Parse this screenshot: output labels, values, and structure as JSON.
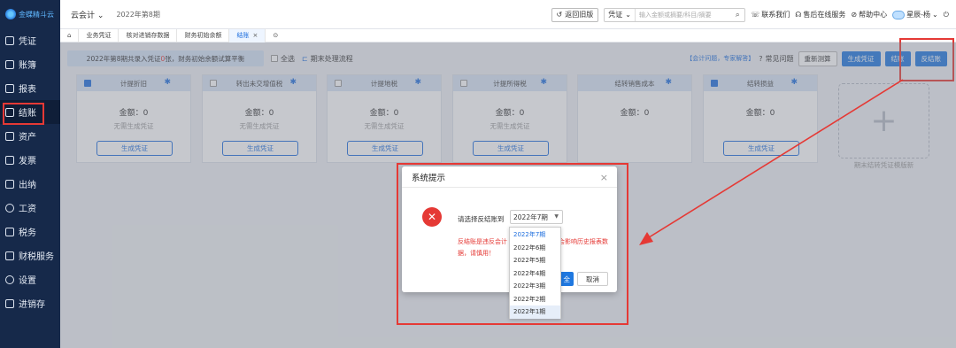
{
  "sidebar": {
    "logo": "金蝶精斗云",
    "items": [
      {
        "label": "凭证"
      },
      {
        "label": "账簿"
      },
      {
        "label": "报表"
      },
      {
        "label": "结账"
      },
      {
        "label": "资产"
      },
      {
        "label": "发票"
      },
      {
        "label": "出纳"
      },
      {
        "label": "工资"
      },
      {
        "label": "税务"
      },
      {
        "label": "财税服务"
      },
      {
        "label": "设置"
      },
      {
        "label": "进销存"
      }
    ]
  },
  "header": {
    "app": "云会计",
    "period": "2022年第8期",
    "return_old": "返回旧版",
    "search_select": "凭证",
    "search_placeholder": "输入金额或摘要/科目/摘要",
    "contact": "联系我们",
    "online_service": "售后在线服务",
    "help": "帮助中心",
    "user": "星辰-杨"
  },
  "tabs": [
    {
      "label": "业务凭证"
    },
    {
      "label": "核对进销存数据"
    },
    {
      "label": "财务初始余额"
    },
    {
      "label": "结账"
    }
  ],
  "toolbar": {
    "summary_prefix": "2022年第8期共录入凭证",
    "summary_count": "0",
    "summary_suffix": "张，财务初始余额试算平衡",
    "select_all": "全选",
    "period_end_process": "期末处理流程",
    "faq_link": "【会计问题，专家解答】",
    "common_questions": "常见问题",
    "recalc": "重新测算",
    "gen_voucher": "生成凭证",
    "close_account": "结账",
    "reverse_close": "反结账"
  },
  "cards": [
    {
      "title": "计提折旧",
      "checked": true
    },
    {
      "title": "转出未交增值税",
      "checked": false
    },
    {
      "title": "计提地税",
      "checked": false
    },
    {
      "title": "计提所得税",
      "checked": false
    },
    {
      "title": "结转销售成本",
      "checked": false
    },
    {
      "title": "结转损益",
      "checked": true
    }
  ],
  "card_common": {
    "amount": "金额：0",
    "no_voucher": "无需生成凭证",
    "gen_button": "生成凭证"
  },
  "add_template_label": "期末结转凭证模版新",
  "dialog": {
    "title": "系统提示",
    "label": "请选择反结账到",
    "selected": "2022年7期",
    "warning_line1_a": "反结账是违反会计",
    "warning_line1_b": "会影响历史报表数",
    "warning_line2": "据，请慎用！",
    "ok": "全",
    "cancel": "取消",
    "options": [
      "2022年7期",
      "2022年6期",
      "2022年5期",
      "2022年4期",
      "2022年3期",
      "2022年2期",
      "2022年1期"
    ]
  },
  "colors": {
    "primary": "#1f78e0",
    "sidebar": "#16294a",
    "highlight": "#e53935"
  }
}
